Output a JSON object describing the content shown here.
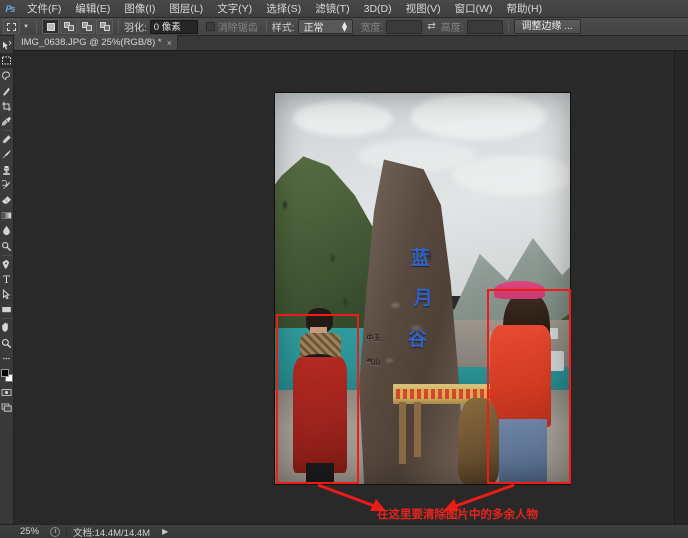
{
  "app": {
    "name": "Adobe Photoshop",
    "logo_text": "Ps"
  },
  "menubar": {
    "items": [
      {
        "label": "文件(F)",
        "name": "menu-file"
      },
      {
        "label": "编辑(E)",
        "name": "menu-edit"
      },
      {
        "label": "图像(I)",
        "name": "menu-image"
      },
      {
        "label": "图层(L)",
        "name": "menu-layer"
      },
      {
        "label": "文字(Y)",
        "name": "menu-type"
      },
      {
        "label": "选择(S)",
        "name": "menu-select"
      },
      {
        "label": "滤镜(T)",
        "name": "menu-filter"
      },
      {
        "label": "3D(D)",
        "name": "menu-3d"
      },
      {
        "label": "视图(V)",
        "name": "menu-view"
      },
      {
        "label": "窗口(W)",
        "name": "menu-window"
      },
      {
        "label": "帮助(H)",
        "name": "menu-help"
      }
    ]
  },
  "options_bar": {
    "active_tool": "rectangular-marquee-tool",
    "selection_modes": [
      {
        "name": "new-selection",
        "active": true
      },
      {
        "name": "add-to-selection",
        "active": false
      },
      {
        "name": "subtract-from-selection",
        "active": false
      },
      {
        "name": "intersect-with-selection",
        "active": false
      }
    ],
    "feather_label": "羽化:",
    "feather_value": "0 像素",
    "antialias_label": "消除锯齿",
    "antialias_checked": false,
    "style_label": "样式:",
    "style_value": "正常",
    "width_label": "宽度:",
    "width_value": "",
    "height_label": "高度:",
    "height_value": "",
    "refine_edge_label": "调整边缘 ..."
  },
  "document_tab": {
    "title": "IMG_0638.JPG @ 25%(RGB/8) *",
    "close_glyph": "×"
  },
  "toolbar": {
    "tools": [
      {
        "name": "move-tool",
        "active": false
      },
      {
        "name": "rectangular-marquee-tool",
        "active": true
      },
      {
        "name": "lasso-tool",
        "active": false
      },
      {
        "name": "quick-selection-tool",
        "active": false
      },
      {
        "name": "crop-tool",
        "active": false
      },
      {
        "name": "eyedropper-tool",
        "active": false
      },
      {
        "name": "spot-healing-brush-tool",
        "active": false
      },
      {
        "name": "brush-tool",
        "active": false
      },
      {
        "name": "clone-stamp-tool",
        "active": false
      },
      {
        "name": "history-brush-tool",
        "active": false
      },
      {
        "name": "eraser-tool",
        "active": false
      },
      {
        "name": "gradient-tool",
        "active": false
      },
      {
        "name": "blur-tool",
        "active": false
      },
      {
        "name": "dodge-tool",
        "active": false
      },
      {
        "name": "pen-tool",
        "active": false
      },
      {
        "name": "horizontal-type-tool",
        "active": false
      },
      {
        "name": "path-selection-tool",
        "active": false
      },
      {
        "name": "rectangle-shape-tool",
        "active": false
      },
      {
        "name": "hand-tool",
        "active": false
      },
      {
        "name": "zoom-tool",
        "active": false
      }
    ],
    "foreground_color": "#000000",
    "background_color": "#ffffff",
    "quick-mask-name": "edit-in-quick-mask-mode",
    "screen-mode-name": "change-screen-mode"
  },
  "canvas": {
    "image_name": "IMG_0638.JPG",
    "zoom": "25%",
    "annotations": {
      "note_text": "在这里要清除图片中的多余人物",
      "note_color": "#e6241d",
      "box_color": "#ef1b17",
      "boxes": [
        {
          "name": "redbox-person-left",
          "label": "boy in red coat"
        },
        {
          "name": "redbox-person-right",
          "label": "woman in red jacket"
        }
      ]
    },
    "photo_content": {
      "monument_text_large": "蓝月谷",
      "monument_text_small": "中玉\n气山"
    }
  },
  "statusbar": {
    "zoom": "25%",
    "doc_info": "文档:14.4M/14.4M",
    "arrow_glyph": "▶"
  }
}
